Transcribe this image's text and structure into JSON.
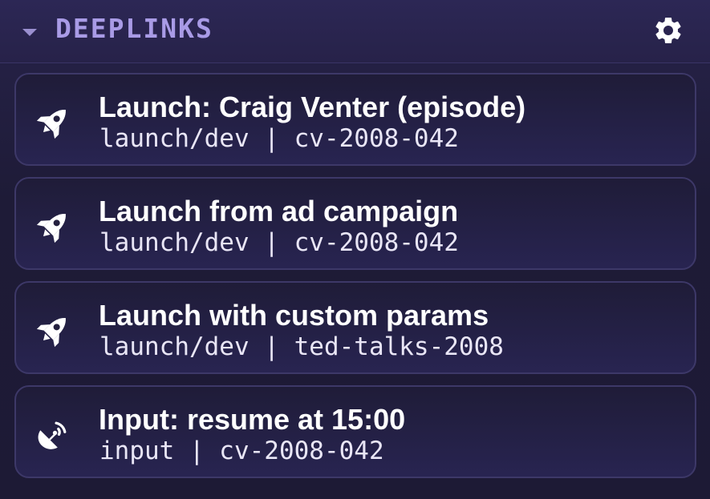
{
  "header": {
    "title": "DEEPLINKS",
    "collapse_icon": "caret-down-icon",
    "settings_icon": "gear-icon"
  },
  "colors": {
    "background": "#1f1c38",
    "header_title": "#a99be6",
    "card_border": "#3d3868",
    "text": "#ffffff"
  },
  "items": [
    {
      "title": "Launch: Craig Venter (episode)",
      "subtitle": "launch/dev | cv-2008-042",
      "icon": "rocket-icon"
    },
    {
      "title": "Launch from ad campaign",
      "subtitle": "launch/dev | cv-2008-042",
      "icon": "rocket-icon"
    },
    {
      "title": "Launch with custom params",
      "subtitle": "launch/dev | ted-talks-2008",
      "icon": "rocket-icon"
    },
    {
      "title": "Input: resume at 15:00",
      "subtitle": "input | cv-2008-042",
      "icon": "satellite-dish-icon"
    }
  ]
}
